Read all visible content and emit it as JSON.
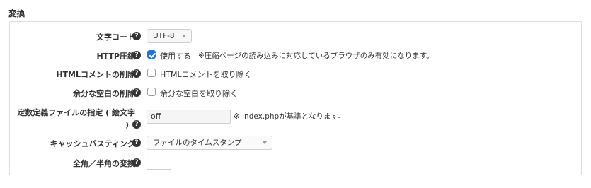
{
  "section": {
    "title": "変換"
  },
  "settings": {
    "charset": {
      "label": "文字コード",
      "value": "UTF-8"
    },
    "http_compress": {
      "label": "HTTP圧縮",
      "checkbox_label": "使用する",
      "checked": true,
      "note": "※圧縮ページの読み込みに対応しているブラウザのみ有効になります。"
    },
    "html_comment": {
      "label": "HTMLコメントの削除",
      "checkbox_label": "HTMLコメントを取り除く",
      "checked": false
    },
    "whitespace": {
      "label": "余分な空白の削除",
      "checkbox_label": "余分な空白を取り除く",
      "checked": false
    },
    "fixed_file": {
      "label_line1": "定数定義ファイルの指定 ( 絵文字",
      "label_line2": ")",
      "value": "off",
      "note": "※ index.phpが基準となります。"
    },
    "cache_busting": {
      "label": "キャッシュバスティング",
      "value": "ファイルのタイムスタンプ"
    },
    "width_conversion": {
      "label": "全角／半角の変換",
      "value": ""
    }
  },
  "icons": {
    "help": "help-circle-icon",
    "dropdown": "chevron-down-icon"
  },
  "help_glyph": "?"
}
